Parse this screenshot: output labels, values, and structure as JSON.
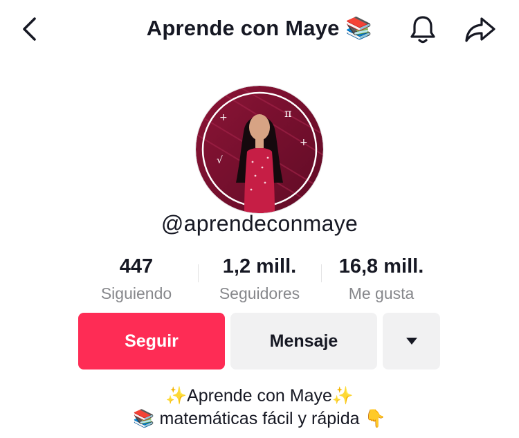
{
  "header": {
    "title": "Aprende con Maye 📚",
    "icons": [
      "back-chevron-icon",
      "bell-icon",
      "share-arrow-icon"
    ]
  },
  "profile": {
    "handle": "@aprendeconmaye",
    "avatar_desc_symbols": [
      "+",
      "π",
      "√",
      "+"
    ]
  },
  "stats": [
    {
      "value": "447",
      "label": "Siguiendo"
    },
    {
      "value": "1,2 mill.",
      "label": "Seguidores"
    },
    {
      "value": "16,8 mill.",
      "label": "Me gusta"
    }
  ],
  "actions": {
    "follow_label": "Seguir",
    "message_label": "Mensaje",
    "more_icon": "caret-down-icon"
  },
  "bio": {
    "line1": "✨Aprende con Maye✨",
    "line2": "📚 matemáticas fácil y rápida 👇"
  },
  "colors": {
    "accent": "#fe2c55",
    "secondary_button": "#f1f1f2",
    "muted_text": "#86878b",
    "avatar_bg": "#7a0f2e"
  }
}
